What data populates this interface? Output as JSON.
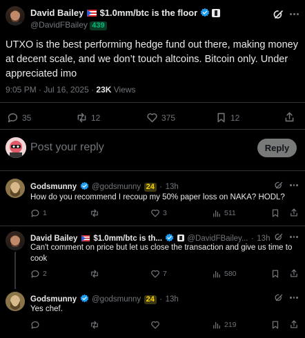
{
  "main_tweet": {
    "author_name": "David Bailey",
    "author_suffix": "$1.0mm/btc is the floor",
    "handle": "@DavidFBailey",
    "handle_badge": "439",
    "text": "UTXO is the best performing hedge fund out there, making money at decent scale, and we don’t touch altcoins. Bitcoin only. Under appreciated imo",
    "time": "9:05 PM · Jul 16, 2025 · ",
    "views_count": "23K",
    "views_label": " Views",
    "replies": "35",
    "reposts": "12",
    "likes": "375",
    "bookmarks": "12"
  },
  "composer": {
    "placeholder": "Post your reply",
    "reply_button": "Reply"
  },
  "replies": [
    {
      "name": "Godsmunny",
      "handle": "@godsmunny",
      "badge": "24",
      "time": "13h",
      "text": "How do you recommend I recoup my 50% paper loss on NAKA?  HODL?",
      "replies": "1",
      "reposts": "",
      "likes": "3",
      "views": "511"
    },
    {
      "name": "David Bailey",
      "suffix": "$1.0mm/btc is th...",
      "handle": "@DavidFBailey...",
      "time": "13h",
      "text": "Can't comment on price but let us close the transaction and give us time to cook",
      "replies": "2",
      "reposts": "",
      "likes": "7",
      "views": "580"
    },
    {
      "name": "Godsmunny",
      "handle": "@godsmunny",
      "badge": "24",
      "time": "13h",
      "text": "Yes chef.",
      "replies": "",
      "reposts": "",
      "likes": "",
      "views": "219"
    }
  ],
  "colors": {
    "accent": "#1d9bf0",
    "badge_green": "#00ba7c",
    "badge_yellow": "#ffd400"
  },
  "sep": "·"
}
